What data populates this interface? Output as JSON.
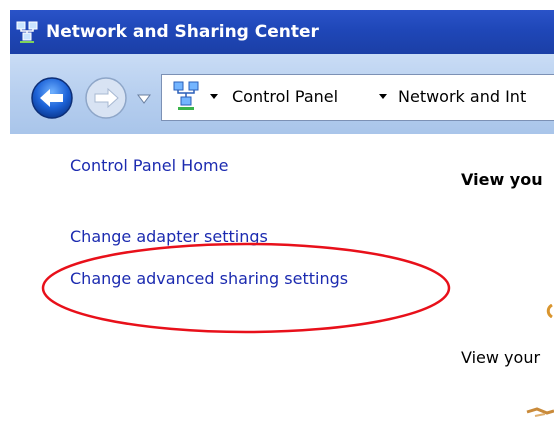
{
  "window": {
    "title": "Network and Sharing Center"
  },
  "navigation": {
    "breadcrumbs": [
      "Control Panel",
      "Network and Int"
    ]
  },
  "sidebar": {
    "items": [
      {
        "label": "Control Panel Home"
      },
      {
        "label": "Change adapter settings"
      },
      {
        "label": "Change advanced sharing settings"
      }
    ]
  },
  "main": {
    "heading": "View you",
    "subtext": "View your"
  },
  "annotation": {
    "highlight_color": "#e8101a"
  },
  "colors": {
    "title_bar": "#1f47b8",
    "nav_bar": "#b7cfef",
    "link": "#1c2bb0"
  }
}
